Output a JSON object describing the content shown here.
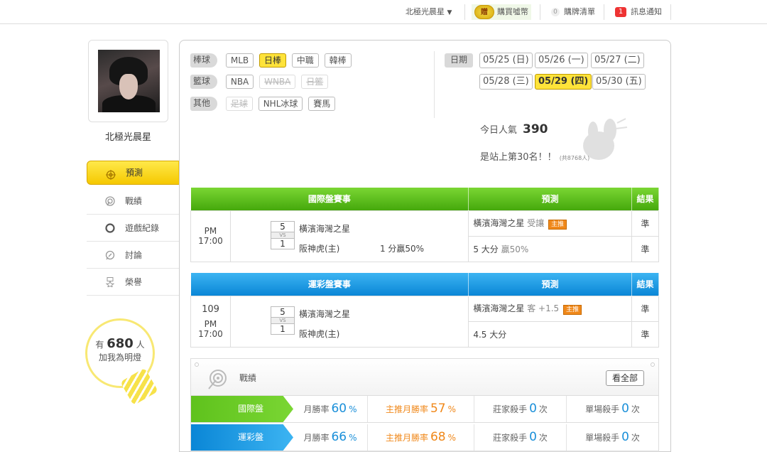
{
  "topbar": {
    "user_menu": "北極光晨星",
    "coin_icon_text": "贈",
    "buy_coins": "購買噓幣",
    "cart_count": "0",
    "cart": "購牌清單",
    "msg_count": "1",
    "messages": "訊息通知"
  },
  "profile": {
    "name": "北極光晨星",
    "fans_prefix": "有",
    "fans_count": "680",
    "fans_unit": "人",
    "fans_suffix": "加我為明燈"
  },
  "nav": [
    {
      "label": "預測",
      "icon": "target-icon",
      "active": true
    },
    {
      "label": "戰績",
      "icon": "record-icon"
    },
    {
      "label": "遊戲紀錄",
      "icon": "circle-icon"
    },
    {
      "label": "討論",
      "icon": "discussion-icon"
    },
    {
      "label": "榮譽",
      "icon": "medal-icon"
    }
  ],
  "filters": {
    "rows": [
      {
        "category": "棒球",
        "chips": [
          "MLB",
          "日棒",
          "中職",
          "韓棒"
        ]
      },
      {
        "category": "籃球",
        "chips": [
          "NBA",
          "WNBA",
          "日籃"
        ]
      },
      {
        "category": "其他",
        "chips": [
          "足球",
          "NHL冰球",
          "賽馬"
        ]
      }
    ],
    "date_label": "日期",
    "dates": [
      "05/25 (日)",
      "05/26 (一)",
      "05/27 (二)",
      "05/28 (三)",
      "05/29 (四)",
      "05/30 (五)"
    ],
    "selected_date": "05/29 (四)",
    "selected_chip": "日棒",
    "disabled_chips": [
      "WNBA",
      "日籃",
      "足球"
    ]
  },
  "stats": {
    "popular_label": "今日人氣",
    "popular_value": "390",
    "rank_text": "是站上第30名！！",
    "rank_total": "(共8768人)"
  },
  "intl_table": {
    "headers": [
      "國際盤賽事",
      "預測",
      "結果"
    ],
    "time": "PM 17:00",
    "score_top": "5",
    "vs": "VS",
    "score_bottom": "1",
    "team_away": "橫濱海灣之星",
    "team_home": "阪神虎(主)",
    "handicap": "1 分贏50%",
    "pred1_team": "橫濱海灣之星",
    "pred1_sub": "受讓",
    "pred1_tag": "主推",
    "pred2_main": "5 大分",
    "pred2_pct": "贏50%",
    "result1": "準",
    "result2": "準"
  },
  "lottery_table": {
    "headers": [
      "運彩盤賽事",
      "預測",
      "結果"
    ],
    "no": "109",
    "time": "PM 17:00",
    "score_top": "5",
    "vs": "VS",
    "score_bottom": "1",
    "team_away": "橫濱海灣之星",
    "team_home": "阪神虎(主)",
    "pred1_team": "橫濱海灣之星",
    "pred1_sub": "客 +1.5",
    "pred1_tag": "主推",
    "pred2_main": "4.5 大分",
    "result1": "準",
    "result2": "準"
  },
  "record": {
    "title": "戰績",
    "see_all": "看全部",
    "rows": [
      {
        "label": "國際盤",
        "win_label": "月勝率",
        "win": "60",
        "top_label": "主推月勝率",
        "top": "57",
        "pct": "%",
        "killer_label": "莊家殺手",
        "killer": "0",
        "single_label": "單場殺手",
        "single": "0",
        "unit": "次"
      },
      {
        "label": "運彩盤",
        "win_label": "月勝率",
        "win": "66",
        "top_label": "主推月勝率",
        "top": "68",
        "pct": "%",
        "killer_label": "莊家殺手",
        "killer": "0",
        "single_label": "單場殺手",
        "single": "0",
        "unit": "次"
      }
    ]
  }
}
